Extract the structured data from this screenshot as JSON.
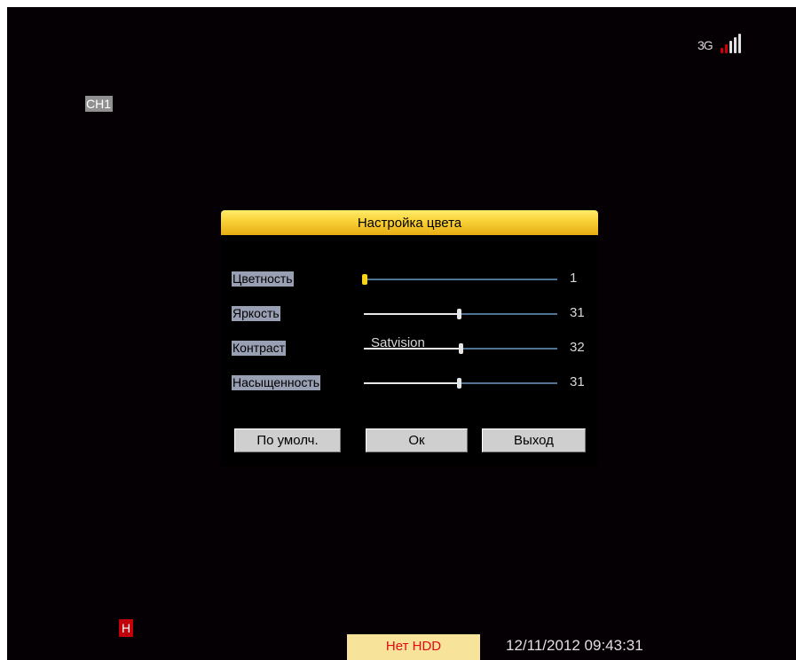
{
  "status": {
    "network_label": "3G",
    "network_icon": "signal-bars-icon",
    "channel": "CH1",
    "h_badge": "H",
    "hdd_status": "Нет HDD",
    "datetime": "12/11/2012 09:43:31"
  },
  "dialog": {
    "title": "Настройка цвета",
    "watermark": "Satvision",
    "sliders": [
      {
        "label": "Цветность",
        "value": "1",
        "level": 0.0
      },
      {
        "label": "Яркость",
        "value": "31",
        "level": 0.49
      },
      {
        "label": "Контраст",
        "value": "32",
        "level": 0.5
      },
      {
        "label": "Насыщенность",
        "value": "31",
        "level": 0.49
      }
    ],
    "buttons": {
      "default": "По умолч.",
      "ok": "Ок",
      "exit": "Выход"
    }
  },
  "colors": {
    "title_bar": "#f9d43a",
    "selected_knob": "#f7d31a",
    "track": "#4f7393",
    "hdd_badge": "#f7e49a",
    "h_badge": "#c0000a"
  }
}
